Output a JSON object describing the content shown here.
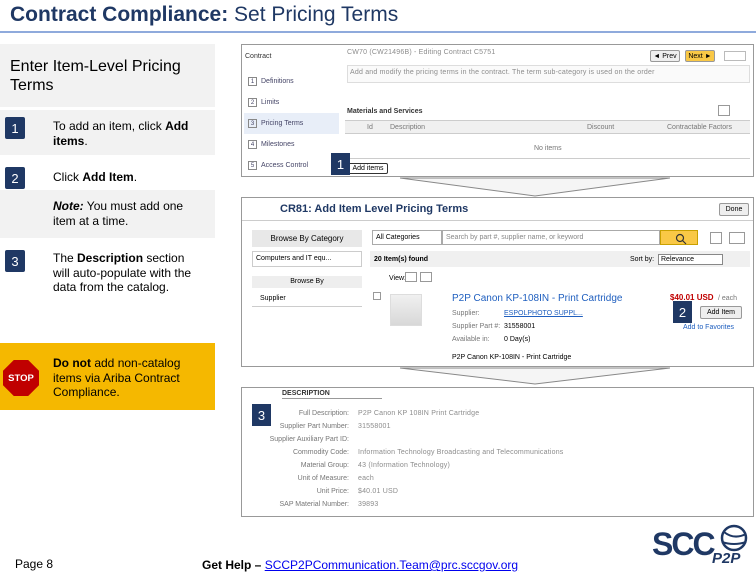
{
  "title": {
    "bold": "Contract Compliance:",
    "rest": " Set Pricing Terms"
  },
  "panel_heading": "Enter Item-Level Pricing Terms",
  "steps": [
    {
      "num": "1",
      "pre": "To add an item, click ",
      "bold": "Add items",
      "post": "."
    },
    {
      "num": "2",
      "pre": "Click ",
      "bold": "Add Item",
      "post": "."
    },
    {
      "note_bold": "Note:",
      "note_text": " You must add one item at a time."
    },
    {
      "num": "3",
      "pre": "The ",
      "bold": "Description",
      "post": " section will auto-populate with the data from the catalog."
    }
  ],
  "stop": {
    "icon": "stop-sign-icon",
    "label": "STOP",
    "bold": "Do not",
    "text": " add non-catalog items via Ariba Contract Compliance."
  },
  "shot1": {
    "contract_label": "Contract",
    "prev": "◄ Prev",
    "next": "Next ►",
    "header_blur": "CW70 (CW21496B) - Editing Contract C5751",
    "sub_blur": "Add and modify the pricing terms in the contract. The term sub-category is used on the order",
    "nav": [
      "Definitions",
      "Limits",
      "Pricing Terms",
      "Milestones",
      "Access Control"
    ],
    "section": "Materials and Services",
    "cols": [
      "Id",
      "Description",
      "Discount",
      "Contractable Factors"
    ],
    "no_items": "No items",
    "add_items": "Add items",
    "marker": "1"
  },
  "shot2": {
    "title": "CR81: Add Item Level Pricing Terms",
    "done": "Done",
    "browse": "Browse By Category",
    "all_categories": "All Categories",
    "search_placeholder": "Search by part #, supplier name, or keyword",
    "computers": "Computers and IT equ...",
    "browse_by": "Browse By",
    "supplier": "Supplier",
    "found": "20 Item(s) found",
    "sort_by": "Sort by:",
    "relevance": "Relevance",
    "view": "View:",
    "product": "P2P Canon KP-108IN - Print Cartridge",
    "price": "$40.01 USD",
    "price_unit": "/ each",
    "supplier_label": "Supplier:",
    "supplier_val": "ESPOLPHOTO SUPPL...",
    "supplier_part_label": "Supplier Part #:",
    "supplier_part_val": "31558001",
    "avail_label": "Available in:",
    "avail_val": "0 Day(s)",
    "add_item": "Add Item",
    "add_fav": "Add to Favorites",
    "desc_line": "P2P Canon KP-108IN - Print Cartridge",
    "marker": "2"
  },
  "shot3": {
    "heading": "DESCRIPTION",
    "rows": [
      {
        "k": "Full Description:",
        "v": "P2P Canon KP 108IN  Print Cartridge"
      },
      {
        "k": "Supplier Part Number:",
        "v": "31558001"
      },
      {
        "k": "Supplier Auxiliary Part ID:",
        "v": ""
      },
      {
        "k": "Commodity Code:",
        "v": "Information Technology Broadcasting and Telecommunications"
      },
      {
        "k": "Material Group:",
        "v": "43 (Information Technology)"
      },
      {
        "k": "Unit of Measure:",
        "v": "each"
      },
      {
        "k": "Unit Price:",
        "v": "$40.01 USD"
      },
      {
        "k": "SAP Material Number:",
        "v": "39893"
      }
    ],
    "marker": "3"
  },
  "footer": {
    "page": "Page 8",
    "help_pre": "Get Help – ",
    "email": "SCCP2PCommunication.Team@prc.sccgov.org"
  },
  "logo": {
    "text1": "SCC",
    "text2": "P2P"
  },
  "colors": {
    "navy": "#1f3864",
    "gray_bg": "#f2f2f2",
    "stop_yellow": "#f5b800",
    "stop_red": "#c00000",
    "price_red": "#c00000",
    "link_blue": "#1f5fbf"
  }
}
